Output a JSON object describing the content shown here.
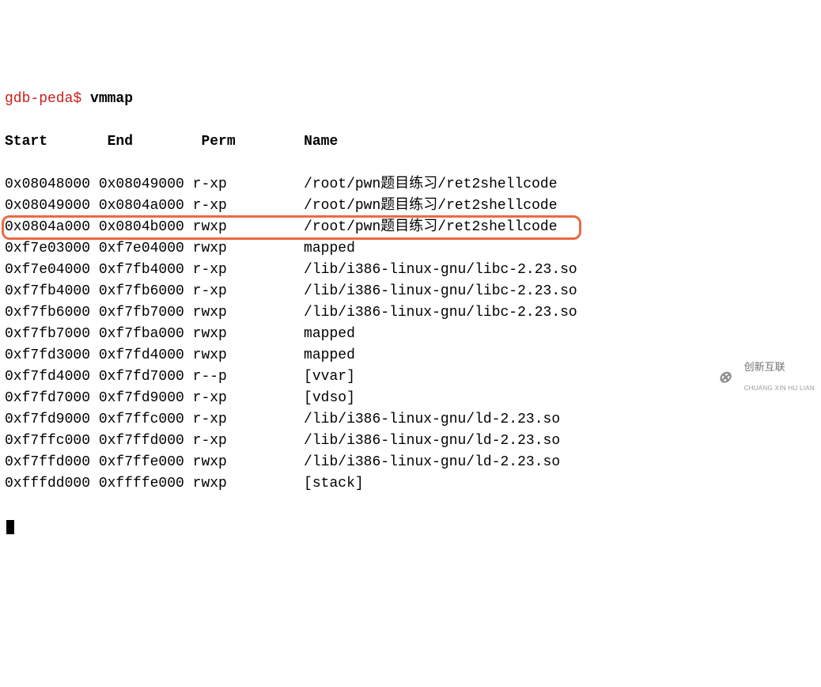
{
  "prompt": "gdb-peda$ ",
  "command": "vmmap",
  "header": {
    "start": "Start",
    "end": "End",
    "perm": "Perm",
    "name": "Name"
  },
  "rows": [
    {
      "start": "0x08048000",
      "end": "0x08049000",
      "perm": "r-xp",
      "name": "/root/pwn题目练习/ret2shellcode",
      "highlight": false
    },
    {
      "start": "0x08049000",
      "end": "0x0804a000",
      "perm": "r-xp",
      "name": "/root/pwn题目练习/ret2shellcode",
      "highlight": false
    },
    {
      "start": "0x0804a000",
      "end": "0x0804b000",
      "perm": "rwxp",
      "name": "/root/pwn题目练习/ret2shellcode",
      "highlight": true
    },
    {
      "start": "0xf7e03000",
      "end": "0xf7e04000",
      "perm": "rwxp",
      "name": "mapped",
      "highlight": false
    },
    {
      "start": "0xf7e04000",
      "end": "0xf7fb4000",
      "perm": "r-xp",
      "name": "/lib/i386-linux-gnu/libc-2.23.so",
      "highlight": false
    },
    {
      "start": "0xf7fb4000",
      "end": "0xf7fb6000",
      "perm": "r-xp",
      "name": "/lib/i386-linux-gnu/libc-2.23.so",
      "highlight": false
    },
    {
      "start": "0xf7fb6000",
      "end": "0xf7fb7000",
      "perm": "rwxp",
      "name": "/lib/i386-linux-gnu/libc-2.23.so",
      "highlight": false
    },
    {
      "start": "0xf7fb7000",
      "end": "0xf7fba000",
      "perm": "rwxp",
      "name": "mapped",
      "highlight": false
    },
    {
      "start": "0xf7fd3000",
      "end": "0xf7fd4000",
      "perm": "rwxp",
      "name": "mapped",
      "highlight": false
    },
    {
      "start": "0xf7fd4000",
      "end": "0xf7fd7000",
      "perm": "r--p",
      "name": "[vvar]",
      "highlight": false
    },
    {
      "start": "0xf7fd7000",
      "end": "0xf7fd9000",
      "perm": "r-xp",
      "name": "[vdso]",
      "highlight": false
    },
    {
      "start": "0xf7fd9000",
      "end": "0xf7ffc000",
      "perm": "r-xp",
      "name": "/lib/i386-linux-gnu/ld-2.23.so",
      "highlight": false
    },
    {
      "start": "0xf7ffc000",
      "end": "0xf7ffd000",
      "perm": "r-xp",
      "name": "/lib/i386-linux-gnu/ld-2.23.so",
      "highlight": false
    },
    {
      "start": "0xf7ffd000",
      "end": "0xf7ffe000",
      "perm": "rwxp",
      "name": "/lib/i386-linux-gnu/ld-2.23.so",
      "highlight": false
    },
    {
      "start": "0xfffdd000",
      "end": "0xffffe000",
      "perm": "rwxp",
      "name": "[stack]",
      "highlight": false
    }
  ],
  "watermark": {
    "line1": "创新互联",
    "line2": "CHUANG XIN HU LIAN"
  }
}
